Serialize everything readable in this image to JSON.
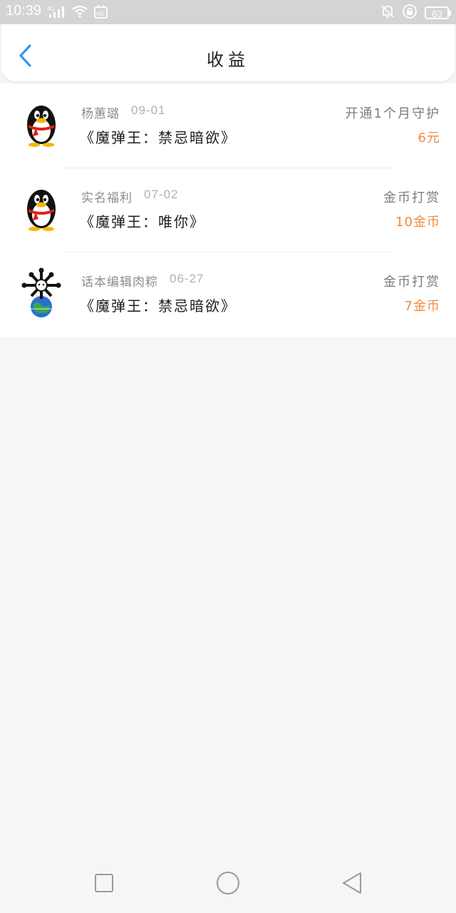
{
  "status_bar": {
    "time": "10:39",
    "network": "4G",
    "hd": "HD",
    "battery": "63"
  },
  "header": {
    "title": "收益",
    "back_icon": "chevron-left-icon"
  },
  "records": [
    {
      "name": "杨蕙璐",
      "date": "09-01",
      "book": "《魔弹王：禁忌暗欲》",
      "type": "开通1个月守护",
      "amount": "6元",
      "avatar_icon": "penguin-avatar-icon"
    },
    {
      "name": "实名福利",
      "date": "07-02",
      "book": "《魔弹王：唯你》",
      "type": "金币打赏",
      "amount": "10金币",
      "avatar_icon": "penguin-avatar-icon"
    },
    {
      "name": "话本编辑肉粽",
      "date": "06-27",
      "book": "《魔弹王：禁忌暗欲》",
      "type": "金币打赏",
      "amount": "7金币",
      "avatar_icon": "globe-bones-avatar-icon"
    }
  ],
  "colors": {
    "accent_blue": "#2e97f2",
    "amount_orange": "#f08a3b",
    "status_bar_bg": "#d4d4d4",
    "page_bg": "#f7f6f7"
  },
  "nav_bar": {
    "icons": [
      "square-recent-apps-icon",
      "circle-home-icon",
      "triangle-back-icon"
    ]
  }
}
